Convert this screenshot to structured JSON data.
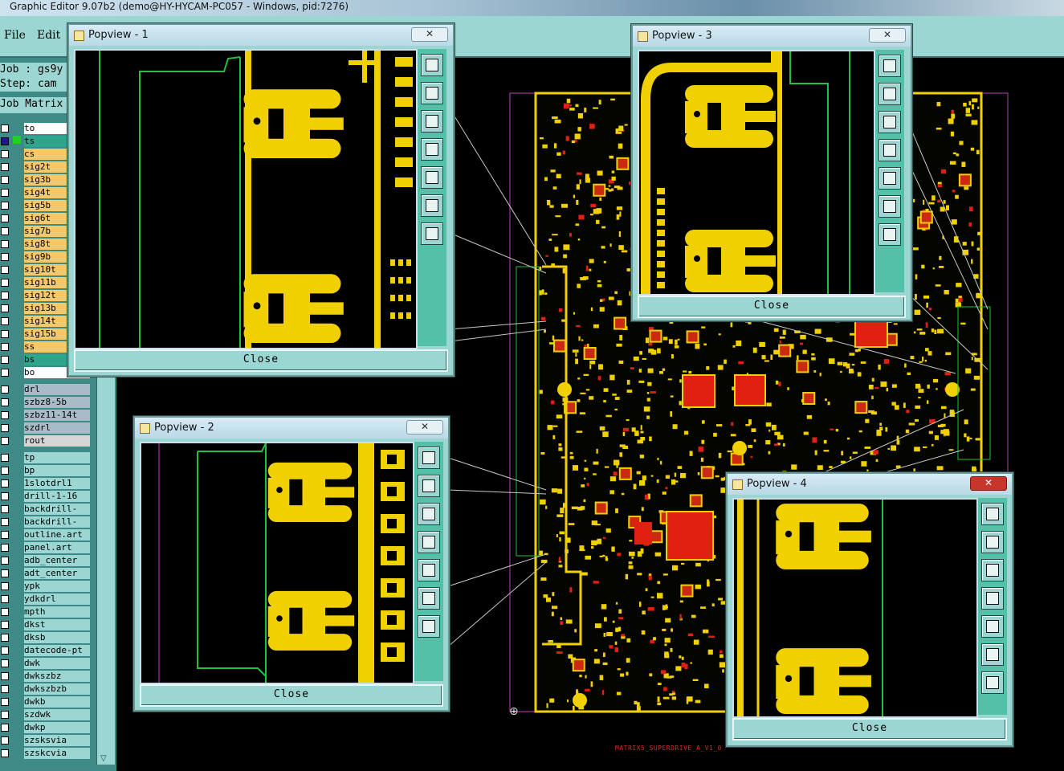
{
  "window": {
    "title": "Graphic Editor 9.07b2 (demo@HY-HYCAM-PC057 - Windows, pid:7276)"
  },
  "menu": {
    "file": "File",
    "edit": "Edit"
  },
  "job": {
    "job_text": "Job : gs9y",
    "step_text": "Step: cam",
    "matrix_label": "Job Matrix"
  },
  "layers": [
    {
      "name": "to",
      "color": "#ffffff"
    },
    {
      "name": "ts",
      "color": "#2fa58b"
    },
    {
      "name": "cs",
      "color": "#f5c86a"
    },
    {
      "name": "sig2t",
      "color": "#f5c86a"
    },
    {
      "name": "sig3b",
      "color": "#f5c86a"
    },
    {
      "name": "sig4t",
      "color": "#f5c86a"
    },
    {
      "name": "sig5b",
      "color": "#f5c86a"
    },
    {
      "name": "sig6t",
      "color": "#f5c86a"
    },
    {
      "name": "sig7b",
      "color": "#f5c86a"
    },
    {
      "name": "sig8t",
      "color": "#f5c86a"
    },
    {
      "name": "sig9b",
      "color": "#f5c86a"
    },
    {
      "name": "sig10t",
      "color": "#f5c86a"
    },
    {
      "name": "sig11b",
      "color": "#f5c86a"
    },
    {
      "name": "sig12t",
      "color": "#f5c86a"
    },
    {
      "name": "sig13b",
      "color": "#f5c86a"
    },
    {
      "name": "sig14t",
      "color": "#f5c86a"
    },
    {
      "name": "sig15b",
      "color": "#f5c86a"
    },
    {
      "name": "ss",
      "color": "#f5c86a"
    },
    {
      "name": "bs",
      "color": "#2fa58b"
    },
    {
      "name": "bo",
      "color": "#ffffff"
    },
    {
      "name": "drl",
      "color": "#a8bcc8"
    },
    {
      "name": "szbz8-5b",
      "color": "#a8bcc8"
    },
    {
      "name": "szbz11-14t",
      "color": "#a8bcc8"
    },
    {
      "name": "szdrl",
      "color": "#a8bcc8"
    },
    {
      "name": "rout",
      "color": "#d6d6d6"
    },
    {
      "name": "tp",
      "color": "#9bd6d2"
    },
    {
      "name": "bp",
      "color": "#9bd6d2"
    },
    {
      "name": "1slotdrl1",
      "color": "#9bd6d2"
    },
    {
      "name": "drill-1-16",
      "color": "#9bd6d2"
    },
    {
      "name": "backdrill-",
      "color": "#9bd6d2"
    },
    {
      "name": "backdrill-",
      "color": "#9bd6d2"
    },
    {
      "name": "outline.art",
      "color": "#9bd6d2"
    },
    {
      "name": "panel.art",
      "color": "#9bd6d2"
    },
    {
      "name": "adb_center",
      "color": "#9bd6d2"
    },
    {
      "name": "adt_center",
      "color": "#9bd6d2"
    },
    {
      "name": "ypk",
      "color": "#9bd6d2"
    },
    {
      "name": "ydkdrl",
      "color": "#9bd6d2"
    },
    {
      "name": "mpth",
      "color": "#9bd6d2"
    },
    {
      "name": "dkst",
      "color": "#9bd6d2"
    },
    {
      "name": "dksb",
      "color": "#9bd6d2"
    },
    {
      "name": "datecode-pt",
      "color": "#9bd6d2"
    },
    {
      "name": "dwk",
      "color": "#9bd6d2"
    },
    {
      "name": "dwkszbz",
      "color": "#9bd6d2"
    },
    {
      "name": "dwkszbzb",
      "color": "#9bd6d2"
    },
    {
      "name": "dwkb",
      "color": "#9bd6d2"
    },
    {
      "name": "szdwk",
      "color": "#9bd6d2"
    },
    {
      "name": "dwkp",
      "color": "#9bd6d2"
    },
    {
      "name": "szsksvia",
      "color": "#9bd6d2"
    },
    {
      "name": "szskcvia",
      "color": "#9bd6d2"
    }
  ],
  "board_label": "MATRIX5_SUPERDRIVE_A_V1_0",
  "popups": [
    {
      "title": "Popview - 1",
      "close": "Close",
      "x_red": false
    },
    {
      "title": "Popview - 2",
      "close": "Close",
      "x_red": false
    },
    {
      "title": "Popview - 3",
      "close": "Close",
      "x_red": false
    },
    {
      "title": "Popview - 4",
      "close": "Close",
      "x_red": true
    }
  ],
  "colors": {
    "copper": "#f0d000",
    "outline": "#20c040",
    "pad_red": "#e02010",
    "menu": "#9bd6d2",
    "tool_strip": "#53c1a8"
  }
}
